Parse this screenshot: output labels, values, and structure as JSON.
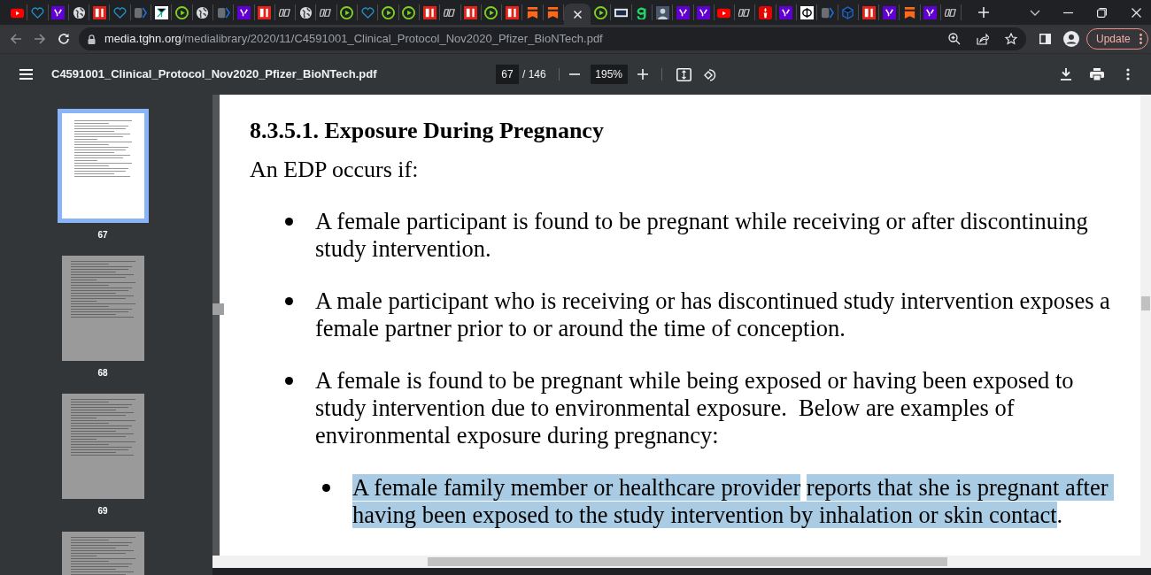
{
  "browser": {
    "tabs": [
      {
        "kind": "youtube",
        "selected": false
      },
      {
        "kind": "heart",
        "selected": false
      },
      {
        "kind": "yahoo",
        "selected": false
      },
      {
        "kind": "globe",
        "selected": false
      },
      {
        "kind": "bi",
        "selected": false
      },
      {
        "kind": "heart",
        "selected": false
      },
      {
        "kind": "arrow",
        "selected": false
      },
      {
        "kind": "grid",
        "selected": false
      },
      {
        "kind": "play",
        "selected": false
      },
      {
        "kind": "globe",
        "selected": false
      },
      {
        "kind": "arrow",
        "selected": false
      },
      {
        "kind": "yahoo",
        "selected": false
      },
      {
        "kind": "bi",
        "selected": false
      },
      {
        "kind": "dr",
        "selected": false
      },
      {
        "kind": "globe",
        "selected": false
      },
      {
        "kind": "dr",
        "selected": false
      },
      {
        "kind": "play",
        "selected": false
      },
      {
        "kind": "heart",
        "selected": false
      },
      {
        "kind": "play",
        "selected": false
      },
      {
        "kind": "play",
        "selected": false
      },
      {
        "kind": "bi",
        "selected": false
      },
      {
        "kind": "dr",
        "selected": false
      },
      {
        "kind": "bi",
        "selected": false
      },
      {
        "kind": "play",
        "selected": false
      },
      {
        "kind": "bi",
        "selected": false
      },
      {
        "kind": "bookmark",
        "selected": false
      },
      {
        "kind": "bookmark",
        "selected": false
      },
      {
        "kind": "pdf",
        "selected": true
      },
      {
        "kind": "play",
        "selected": false
      },
      {
        "kind": "news",
        "selected": false
      },
      {
        "kind": "g",
        "selected": false
      },
      {
        "kind": "avatar",
        "selected": false
      },
      {
        "kind": "yahoo",
        "selected": false
      },
      {
        "kind": "yahoo",
        "selected": false
      },
      {
        "kind": "youtube",
        "selected": false
      },
      {
        "kind": "dr",
        "selected": false
      },
      {
        "kind": "torch",
        "selected": false
      },
      {
        "kind": "yahoo",
        "selected": false
      },
      {
        "kind": "phi",
        "selected": false
      },
      {
        "kind": "arrow",
        "selected": false
      },
      {
        "kind": "cube",
        "selected": false
      },
      {
        "kind": "bi",
        "selected": false
      },
      {
        "kind": "yahoo",
        "selected": false
      },
      {
        "kind": "bookmark",
        "selected": false
      },
      {
        "kind": "yahoo",
        "selected": false
      },
      {
        "kind": "dr",
        "selected": false
      }
    ],
    "address": {
      "host": "media.tghn.org",
      "path": "/medialibrary/2020/11/C4591001_Clinical_Protocol_Nov2020_Pfizer_BioNTech.pdf"
    },
    "update_button": "Update"
  },
  "pdf_toolbar": {
    "title": "C4591001_Clinical_Protocol_Nov2020_Pfizer_BioNTech.pdf",
    "page": "67",
    "page_count": "/ 146",
    "zoom": "195%"
  },
  "thumbnails": [
    {
      "label": "67",
      "selected": true
    },
    {
      "label": "68",
      "selected": false
    },
    {
      "label": "69",
      "selected": false
    },
    {
      "selected": false
    }
  ],
  "document": {
    "heading": "8.3.5.1. Exposure During Pregnancy",
    "intro": "An EDP occurs if:",
    "bullets": [
      {
        "segments": [
          {
            "text": "A female participant is found to be pregnant while receiving or after discontinuing study intervention.",
            "highlighted": false
          }
        ]
      },
      {
        "segments": [
          {
            "text": "A male participant who is receiving or has discontinued study intervention exposes a female partner prior to or around the time of conception.",
            "highlighted": false
          }
        ]
      },
      {
        "segments": [
          {
            "text": "A female is found to be pregnant while being exposed or having been exposed to study intervention due to environmental exposure.  Below are examples of environmental exposure during pregnancy:",
            "highlighted": false
          }
        ],
        "children": [
          {
            "segments": [
              {
                "text": "A female family member or healthcare provider",
                "highlighted": true
              },
              {
                "text": "reports that she is pregnant after having been exposed to the study intervention by inhalation or skin contact",
                "highlighted": true,
                "space_before": true
              },
              {
                "text": ".",
                "highlighted": false
              }
            ]
          }
        ]
      }
    ]
  }
}
